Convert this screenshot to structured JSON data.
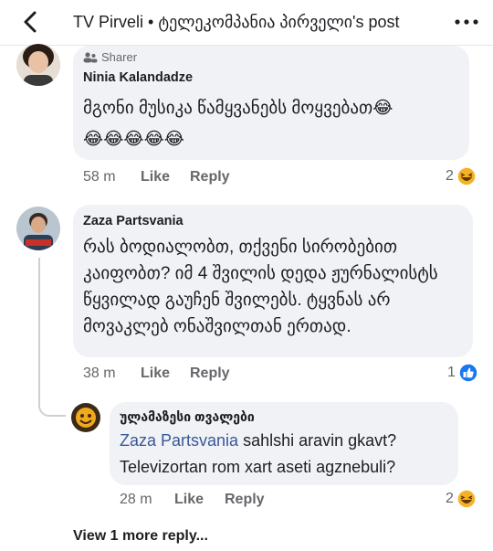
{
  "header": {
    "title": "TV Pirveli • ტელეკომპანია პირველი's post"
  },
  "comments": [
    {
      "badge": "Sharer",
      "author": "Ninia Kalandadze",
      "text_line1": "მგონი მუსიკა წამყვანებს მოყვებათ😂",
      "text_line2": "😂😂😂😂😂",
      "time": "58 m",
      "like_label": "Like",
      "reply_label": "Reply",
      "reaction_count": "2"
    },
    {
      "author": "Zaza Partsvania",
      "text": "რას ბოდიალობთ, თქვენი სირობებით კაიფობთ? იმ 4 შვილის დედა ჟურნალისტს წყვილად გაუჩენ შვილებს. ტყვნას არ მოვაკლებ ონაშვილთან ერთად.",
      "time": "38 m",
      "like_label": "Like",
      "reply_label": "Reply",
      "reaction_count": "1"
    },
    {
      "author": "ულამაზესი თვალები",
      "mention": "Zaza Partsvania",
      "text_after_mention": "sahlshi aravin gkavt? Televizortan rom xart aseti agznebuli?",
      "time": "28 m",
      "like_label": "Like",
      "reply_label": "Reply",
      "reaction_count": "2"
    }
  ],
  "view_more_label": "View 1 more reply...",
  "icons": {
    "back": "chevron-left-icon",
    "more": "more-dots-icon",
    "sharer": "people-icon",
    "laugh": "laugh-reaction-icon",
    "like": "like-reaction-icon"
  },
  "colors": {
    "bubble": "#f0f2f5",
    "link": "#385898",
    "meta": "#65676b",
    "like_blue": "#1877f2",
    "emoji_yellow": "#f7b125"
  }
}
